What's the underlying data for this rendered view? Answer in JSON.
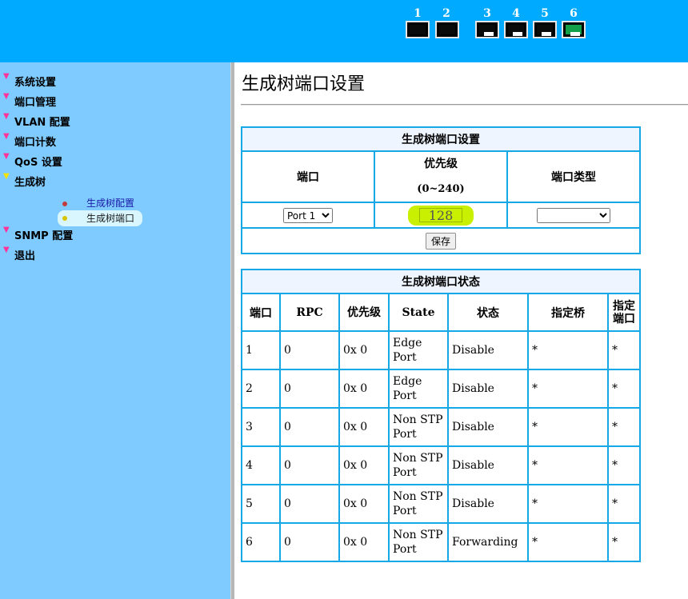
{
  "banner": {
    "ports": [
      {
        "num": "1",
        "status": "down",
        "style": "sfp"
      },
      {
        "num": "2",
        "status": "down",
        "style": "sfp"
      },
      {
        "num": "3",
        "status": "down",
        "style": "rj45"
      },
      {
        "num": "4",
        "status": "down",
        "style": "rj45"
      },
      {
        "num": "5",
        "status": "down",
        "style": "rj45"
      },
      {
        "num": "6",
        "status": "up",
        "style": "rj45"
      }
    ],
    "colors": {
      "background": "#00aaff",
      "link_up": "#14a04a"
    }
  },
  "sidebar": {
    "items": [
      {
        "label": "系统设置"
      },
      {
        "label": "端口管理"
      },
      {
        "label": "VLAN 配置"
      },
      {
        "label": "端口计数"
      },
      {
        "label": "QoS 设置"
      },
      {
        "label": "生成树"
      },
      {
        "label": "SNMP 配置"
      },
      {
        "label": "退出"
      }
    ],
    "subitems": [
      {
        "label": "生成树配置",
        "selected": false
      },
      {
        "label": "生成树端口",
        "selected": true
      }
    ],
    "colors": {
      "background": "#7fcbff"
    }
  },
  "main": {
    "title": "生成树端口设置",
    "settings": {
      "caption": "生成树端口设置",
      "col_port": "端口",
      "col_priority": "优先级",
      "col_priority_range": "(0~240)",
      "col_type": "端口类型",
      "port_value": "Port 1",
      "priority_value": "128",
      "type_value": "",
      "save_label": "保存"
    },
    "status": {
      "caption": "生成树端口状态",
      "headers": [
        "端口",
        "RPC",
        "优先级",
        "State",
        "状态",
        "指定桥",
        "指定端口"
      ],
      "rows": [
        [
          "1",
          "0",
          "0x 0",
          "Edge Port",
          "Disable",
          "*",
          "*"
        ],
        [
          "2",
          "0",
          "0x 0",
          "Edge Port",
          "Disable",
          "*",
          "*"
        ],
        [
          "3",
          "0",
          "0x 0",
          "Non STP Port",
          "Disable",
          "*",
          "*"
        ],
        [
          "4",
          "0",
          "0x 0",
          "Non STP Port",
          "Disable",
          "*",
          "*"
        ],
        [
          "5",
          "0",
          "0x 0",
          "Non STP Port",
          "Disable",
          "*",
          "*"
        ],
        [
          "6",
          "0",
          "0x 0",
          "Non STP Port",
          "Forwarding",
          "*",
          "*"
        ]
      ]
    }
  }
}
